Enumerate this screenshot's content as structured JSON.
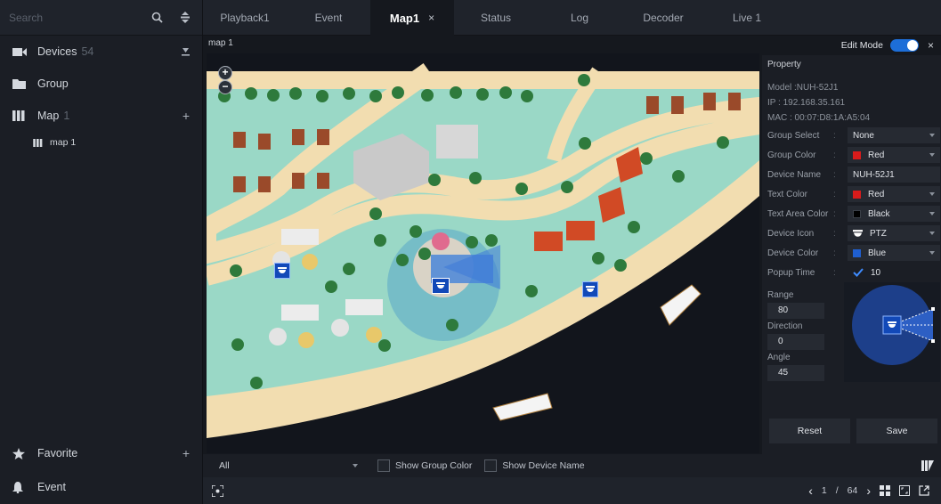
{
  "sidebar": {
    "search_placeholder": "Search",
    "items": [
      {
        "label": "Devices",
        "count": "54"
      },
      {
        "label": "Group"
      },
      {
        "label": "Map",
        "count": "1"
      }
    ],
    "map_child": "map 1",
    "favorite": "Favorite",
    "event": "Event"
  },
  "tabs": [
    {
      "label": "Playback1"
    },
    {
      "label": "Event"
    },
    {
      "label": "Map1",
      "close": "×"
    },
    {
      "label": "Status"
    },
    {
      "label": "Log"
    },
    {
      "label": "Decoder"
    },
    {
      "label": "Live 1"
    }
  ],
  "map": {
    "name": "map 1",
    "zoom_in": "+",
    "zoom_out": "−"
  },
  "edit": {
    "label": "Edit Mode",
    "enabled": true,
    "close": "×"
  },
  "property": {
    "title": "Property",
    "model": "Model :NUH-52J1",
    "ip": "IP : 192.168.35.161",
    "mac": "MAC : 00:07:D8:1A:A5:04",
    "rows": [
      {
        "label": "Group Select",
        "value": "None",
        "swatch": ""
      },
      {
        "label": "Group Color",
        "value": "Red",
        "swatch": "#d91b1b"
      },
      {
        "label": "Device Name",
        "value": "NUH-52J1",
        "swatch": ""
      },
      {
        "label": "Text Color",
        "value": "Red",
        "swatch": "#d91b1b"
      },
      {
        "label": "Text Area Color",
        "value": "Black",
        "swatch": "#000000"
      },
      {
        "label": "Device Icon",
        "value": "PTZ",
        "swatch": ""
      },
      {
        "label": "Device Color",
        "value": "Blue",
        "swatch": "#1f5fd1"
      },
      {
        "label": "Popup Time",
        "value": "10",
        "swatch": ""
      }
    ],
    "range_label": "Range",
    "range": "80",
    "direction_label": "Direction",
    "direction": "0",
    "angle_label": "Angle",
    "angle": "45",
    "reset": "Reset",
    "save": "Save"
  },
  "filter": {
    "layer": "All",
    "show_group_color": "Show Group Color",
    "show_device_name": "Show Device Name"
  },
  "pager": {
    "current": "1",
    "sep": "/",
    "total": "64"
  },
  "colors": {
    "accent": "#1d6ed8",
    "device_blue": "#1249b8",
    "water": "#9ad8c6",
    "sand": "#f2ddb0",
    "sea": "#12151c"
  }
}
